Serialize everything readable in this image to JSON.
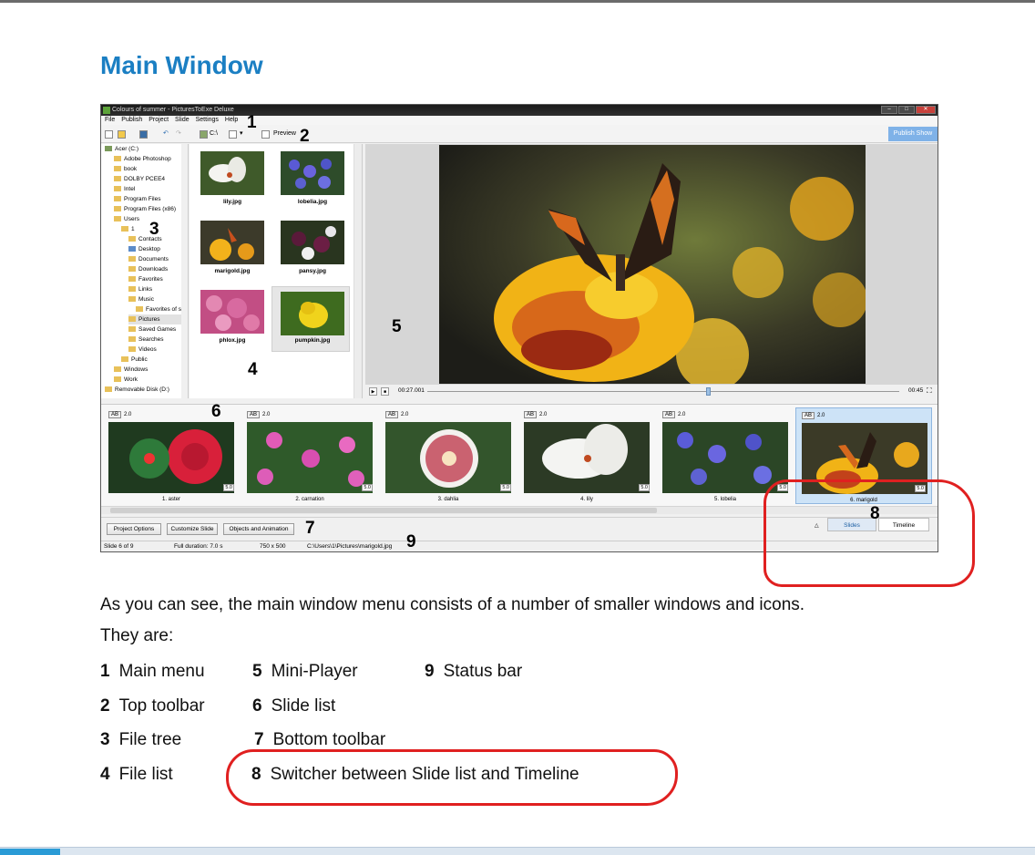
{
  "heading": "Main Window",
  "app": {
    "window_title": "Colours of summer - PicturesToExe Deluxe",
    "menu": [
      "File",
      "Publish",
      "Project",
      "Slide",
      "Settings",
      "Help"
    ],
    "toolbar": {
      "path_label": "C:\\",
      "preview_label": "Preview",
      "publish_label": "Publish Show"
    },
    "tree": [
      "Acer (C:)",
      "Adobe Photoshop",
      "book",
      "DOLBY PCEE4",
      "Intel",
      "Program Files",
      "Program Files (x86)",
      "Users",
      "1",
      "Contacts",
      "Desktop",
      "Documents",
      "Downloads",
      "Favorites",
      "Links",
      "Music",
      "Favorites of s",
      "Pictures",
      "Saved Games",
      "Searches",
      "Videos",
      "Public",
      "Windows",
      "Work",
      "Removable Disk (D:)"
    ],
    "files": [
      "lily.jpg",
      "lobelia.jpg",
      "marigold.jpg",
      "pansy.jpg",
      "phlox.jpg",
      "pumpkin.jpg"
    ],
    "player": {
      "time_current": "00:27.001",
      "time_total": "00:45"
    },
    "slides": [
      {
        "ab": "AB",
        "trans": "2.0",
        "dur": "5.0",
        "caption": "1. aster"
      },
      {
        "ab": "AB",
        "trans": "2.0",
        "dur": "5.0",
        "caption": "2. carnation"
      },
      {
        "ab": "AB",
        "trans": "2.0",
        "dur": "5.0",
        "caption": "3. dahlia"
      },
      {
        "ab": "AB",
        "trans": "2.0",
        "dur": "5.0",
        "caption": "4. lily"
      },
      {
        "ab": "AB",
        "trans": "2.0",
        "dur": "5.0",
        "caption": "5. lobelia"
      },
      {
        "ab": "AB",
        "trans": "2.0",
        "dur": "5.0",
        "caption": "6. marigold"
      }
    ],
    "bottom_buttons": [
      "Project Options",
      "Customize Slide",
      "Objects and Animation"
    ],
    "switch": {
      "slides": "Slides",
      "timeline": "Timeline"
    },
    "status": {
      "slide": "Slide 6 of 9",
      "duration": "Full duration: 7.0 s",
      "size": "750 x 500",
      "path": "C:\\Users\\1\\Pictures\\marigold.jpg"
    }
  },
  "callouts": [
    "1",
    "2",
    "3",
    "4",
    "5",
    "6",
    "7",
    "8",
    "9"
  ],
  "paragraph": [
    "As you can see, the main window menu consists of a number of smaller windows and icons.",
    "They are:"
  ],
  "legend": [
    {
      "n": "1",
      "label": "Main menu"
    },
    {
      "n": "2",
      "label": "Top toolbar"
    },
    {
      "n": "3",
      "label": "File tree"
    },
    {
      "n": "4",
      "label": "File list"
    },
    {
      "n": "5",
      "label": "Mini-Player"
    },
    {
      "n": "6",
      "label": "Slide list"
    },
    {
      "n": "7",
      "label": "Bottom toolbar"
    },
    {
      "n": "8",
      "label": "Switcher between Slide list and Timeline"
    },
    {
      "n": "9",
      "label": "Status bar"
    }
  ],
  "colors": {
    "heading": "#1b7fc3",
    "highlight": "#e02020",
    "selection": "#cde3f7",
    "publish": "#7fb2e8"
  }
}
